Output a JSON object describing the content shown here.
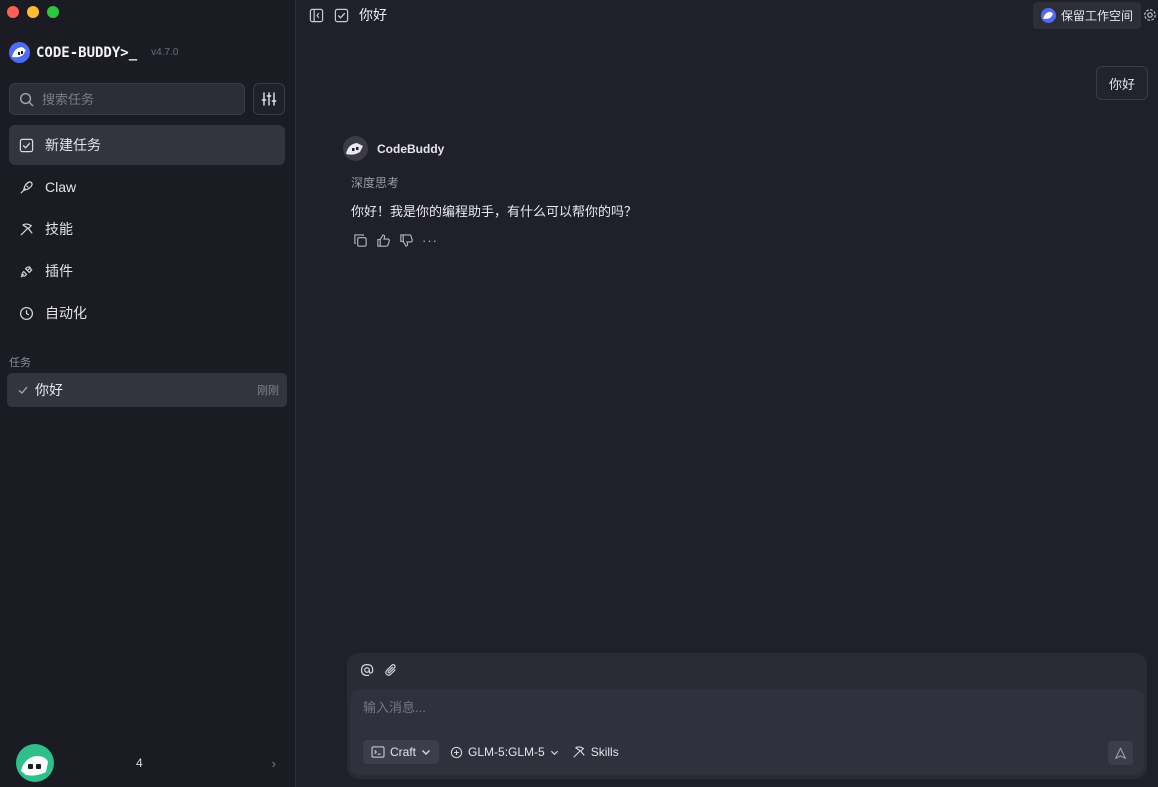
{
  "app": {
    "brand_name": "CODE-BUDDY>_",
    "version": "v4.7.0"
  },
  "sidebar": {
    "search_placeholder": "搜索任务",
    "nav": [
      {
        "label": "新建任务",
        "icon": "new-task-icon",
        "active": true
      },
      {
        "label": "Claw",
        "icon": "claw-icon",
        "active": false
      },
      {
        "label": "技能",
        "icon": "skills-icon",
        "active": false
      },
      {
        "label": "插件",
        "icon": "plugin-icon",
        "active": false
      },
      {
        "label": "自动化",
        "icon": "clock-icon",
        "active": false
      }
    ],
    "tasks_section_label": "任务",
    "tasks": [
      {
        "title": "你好",
        "time": "刚刚",
        "status_icon": "check-icon"
      }
    ],
    "user": {
      "name": "4"
    }
  },
  "topbar": {
    "title": "你好",
    "keep_workspace_label": "保留工作空间"
  },
  "conversation": {
    "user_message": "你好",
    "assistant_name": "CodeBuddy",
    "thinking_label": "深度思考",
    "assistant_reply": "你好！我是你的编程助手，有什么可以帮你的吗？"
  },
  "composer": {
    "placeholder": "输入消息...",
    "mode_label": "Craft",
    "model_label": "GLM-5:GLM-5",
    "skills_label": "Skills"
  },
  "colors": {
    "background": "#1f2029",
    "sidebar": "#1b1c23",
    "active_item": "#33343e",
    "brand_blue": "#4f6bf5"
  }
}
